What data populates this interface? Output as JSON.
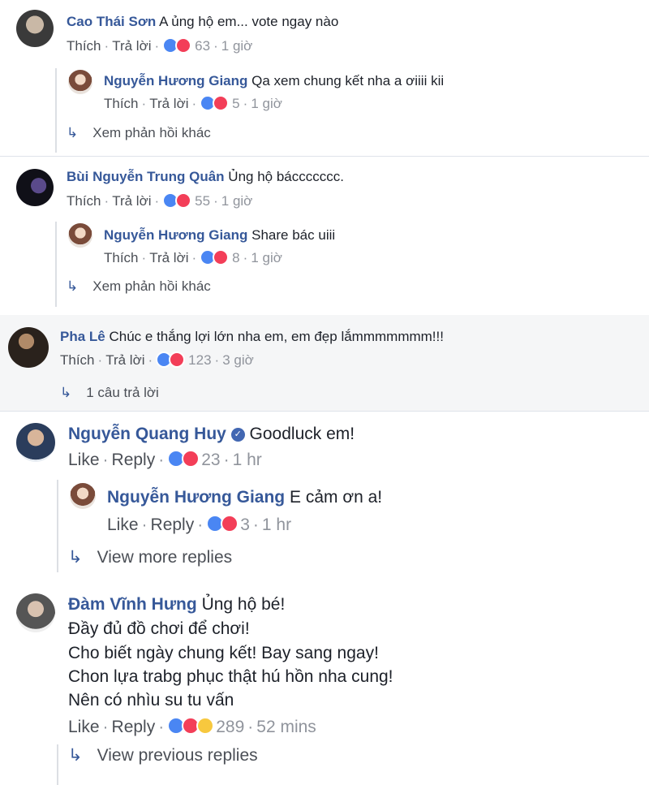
{
  "comments": [
    {
      "name": "Cao Thái Sơn",
      "text": "A ủng hộ em... vote ngay nào",
      "like_label": "Thích",
      "reply_label": "Trả lời",
      "reaction_count": "63",
      "time": "1 giờ",
      "reply": {
        "name": "Nguyễn Hương Giang",
        "text": "Qa xem chung kết nha a ơiiii kii",
        "like_label": "Thích",
        "reply_label": "Trả lời",
        "reaction_count": "5",
        "time": "1 giờ"
      },
      "more_label": "Xem phản hồi khác"
    },
    {
      "name": "Bùi Nguyễn Trung Quân",
      "text": "Ủng hộ báccccccc.",
      "like_label": "Thích",
      "reply_label": "Trả lời",
      "reaction_count": "55",
      "time": "1 giờ",
      "reply": {
        "name": "Nguyễn Hương Giang",
        "text": "Share bác uiii",
        "like_label": "Thích",
        "reply_label": "Trả lời",
        "reaction_count": "8",
        "time": "1 giờ"
      },
      "more_label": "Xem phản hồi khác"
    },
    {
      "name": "Pha Lê",
      "text": "Chúc e thắng lợi lớn nha em, em đẹp lắmmmmmmm!!!",
      "like_label": "Thích",
      "reply_label": "Trả lời",
      "reaction_count": "123",
      "time": "3 giờ",
      "more_label": "1 câu trả lời"
    },
    {
      "name": "Nguyễn Quang Huy",
      "text": "Goodluck em!",
      "like_label": "Like",
      "reply_label": "Reply",
      "reaction_count": "23",
      "time": "1 hr",
      "reply": {
        "name": "Nguyễn Hương Giang",
        "text": "E cảm ơn a!",
        "like_label": "Like",
        "reply_label": "Reply",
        "reaction_count": "3",
        "time": "1 hr"
      },
      "more_label": "View more replies"
    },
    {
      "name": "Đàm Vĩnh Hưng",
      "text": "Ủng hộ bé!",
      "text_lines": [
        "Đầy đủ đồ chơi để chơi!",
        "Cho biết ngày chung kết! Bay sang ngay!",
        "Chon lựa trabg phục thật hú hồn nha cung!",
        "Nên có nhìu su tu vấn"
      ],
      "like_label": "Like",
      "reply_label": "Reply",
      "reaction_count": "289",
      "time": "52 mins",
      "more_label": "View previous replies"
    }
  ],
  "separator": "·",
  "arrow_glyph": "↳",
  "colors": {
    "name": "#365899",
    "meta": "#90949c",
    "like": "#4a86f3",
    "love": "#f33e58",
    "haha": "#f7c83e"
  }
}
